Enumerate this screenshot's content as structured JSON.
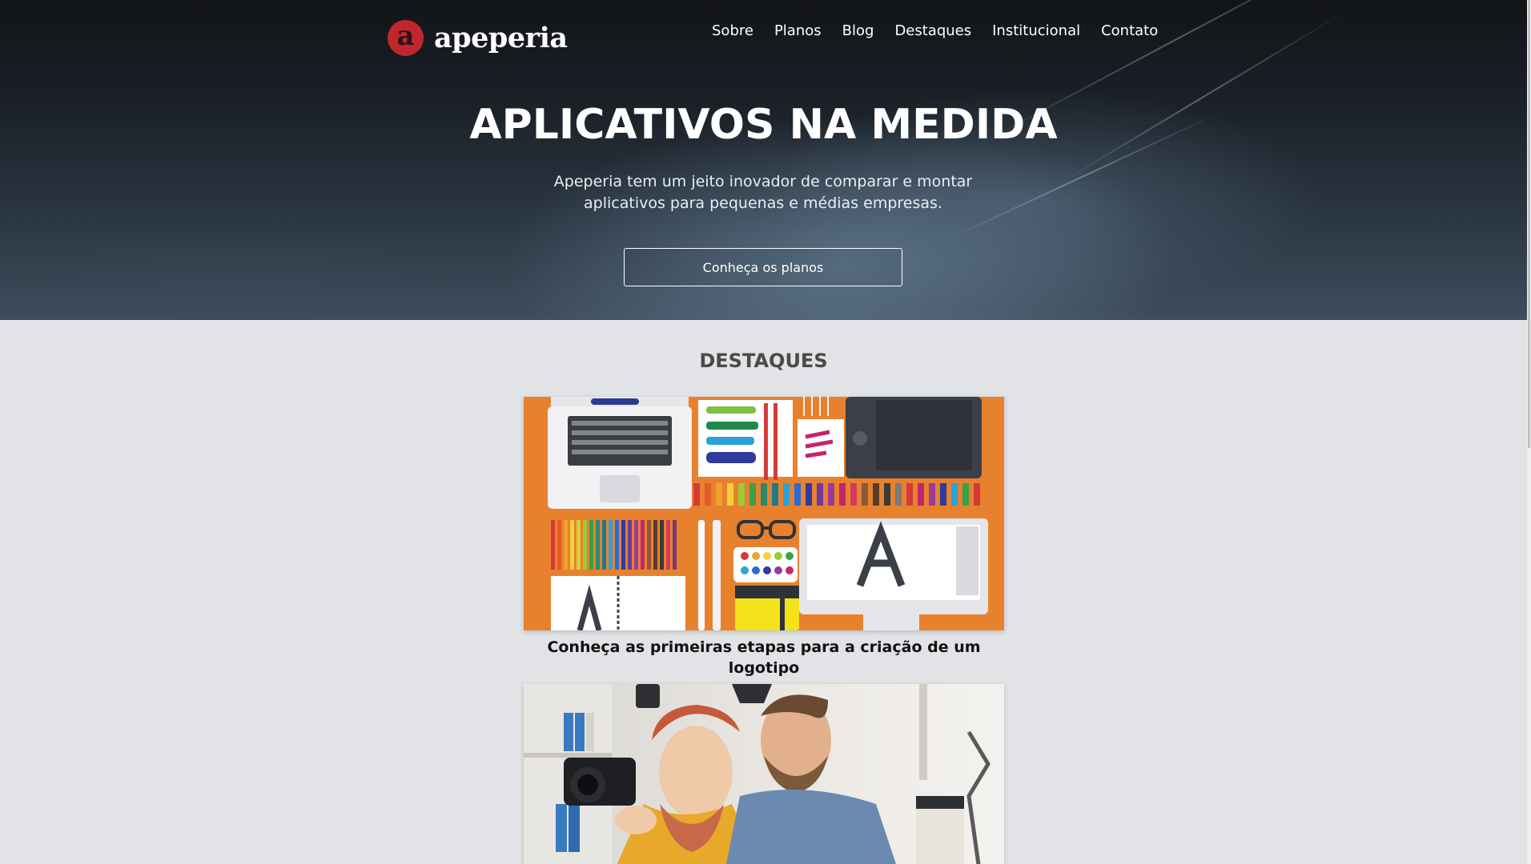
{
  "brand": {
    "mark_letter": "a",
    "name": "apeperia"
  },
  "nav": {
    "items": [
      {
        "label": "Sobre"
      },
      {
        "label": "Planos"
      },
      {
        "label": "Blog"
      },
      {
        "label": "Destaques"
      },
      {
        "label": "Institucional"
      },
      {
        "label": "Contato"
      }
    ]
  },
  "hero": {
    "title": "APLICATIVOS NA MEDIDA",
    "text_line1": "Apeperia tem um jeito inovador de comparar e montar",
    "text_line2": "aplicativos para pequenas e médias empresas.",
    "button_label": "Conheça os planos"
  },
  "highlights": {
    "title": "DESTAQUES",
    "cards": [
      {
        "caption": "Conheça as primeiras etapas para a criação de um logotipo"
      },
      {
        "caption": ""
      }
    ]
  },
  "colors": {
    "brand_red": "#c0272d",
    "page_background": "#e1e3e6",
    "illustration_orange": "#e8812e"
  }
}
